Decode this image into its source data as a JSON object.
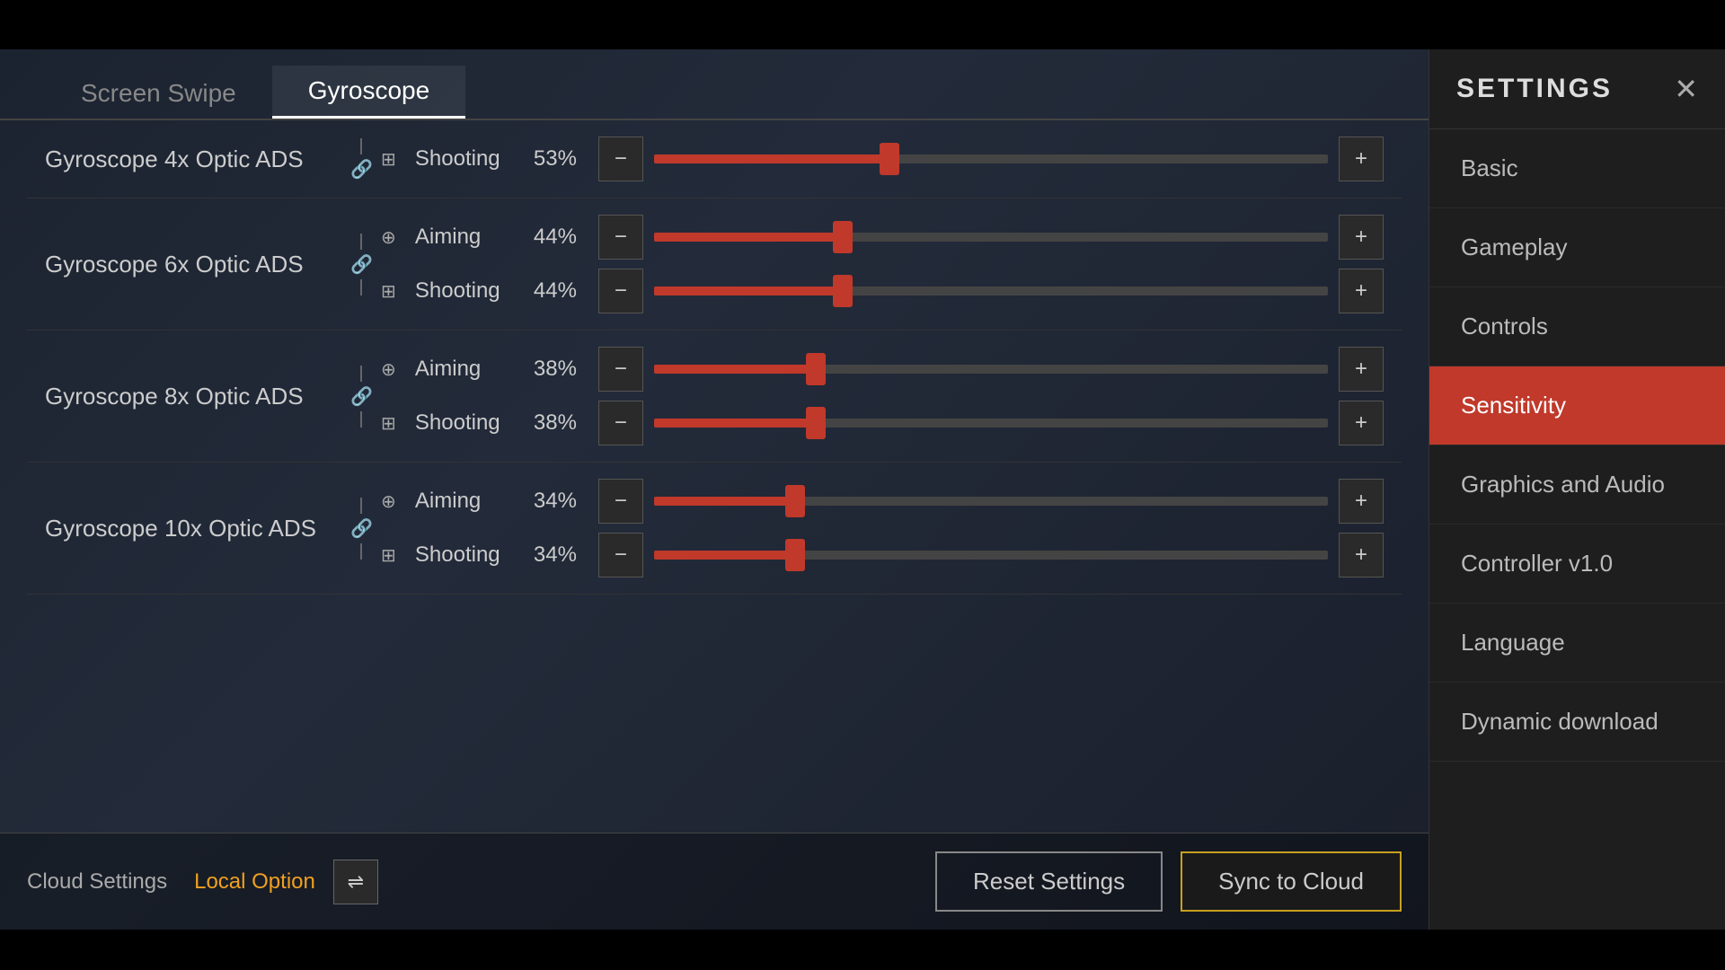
{
  "topBar": {
    "height": 55
  },
  "tabs": {
    "items": [
      {
        "label": "Screen Swipe",
        "active": false
      },
      {
        "label": "Gyroscope",
        "active": true
      }
    ]
  },
  "settings": {
    "title": "SETTINGS",
    "closeIcon": "✕",
    "menuItems": [
      {
        "label": "Basic",
        "active": false
      },
      {
        "label": "Gameplay",
        "active": false
      },
      {
        "label": "Controls",
        "active": false
      },
      {
        "label": "Sensitivity",
        "active": true
      },
      {
        "label": "Graphics and Audio",
        "active": false
      },
      {
        "label": "Controller v1.0",
        "active": false
      },
      {
        "label": "Language",
        "active": false
      },
      {
        "label": "Dynamic download",
        "active": false
      }
    ]
  },
  "gyroSections": [
    {
      "id": "4x",
      "label": "Gyroscope 4x Optic ADS",
      "rows": [
        {
          "type": "shooting",
          "label": "Shooting",
          "value": "53%",
          "fillPct": 35
        }
      ],
      "linked": false,
      "partialTop": true
    },
    {
      "id": "6x",
      "label": "Gyroscope 6x Optic ADS",
      "rows": [
        {
          "type": "aiming",
          "label": "Aiming",
          "value": "44%",
          "fillPct": 28
        },
        {
          "type": "shooting",
          "label": "Shooting",
          "value": "44%",
          "fillPct": 28
        }
      ],
      "linked": true
    },
    {
      "id": "8x",
      "label": "Gyroscope 8x Optic ADS",
      "rows": [
        {
          "type": "aiming",
          "label": "Aiming",
          "value": "38%",
          "fillPct": 24
        },
        {
          "type": "shooting",
          "label": "Shooting",
          "value": "38%",
          "fillPct": 24
        }
      ],
      "linked": true
    },
    {
      "id": "10x",
      "label": "Gyroscope 10x Optic ADS",
      "rows": [
        {
          "type": "aiming",
          "label": "Aiming",
          "value": "34%",
          "fillPct": 21
        },
        {
          "type": "shooting",
          "label": "Shooting",
          "value": "34%",
          "fillPct": 21
        }
      ],
      "linked": true
    }
  ],
  "footer": {
    "cloudSettingsLabel": "Cloud Settings",
    "localOptionLabel": "Local Option",
    "transferIcon": "⇌",
    "resetLabel": "Reset Settings",
    "syncLabel": "Sync to Cloud"
  }
}
